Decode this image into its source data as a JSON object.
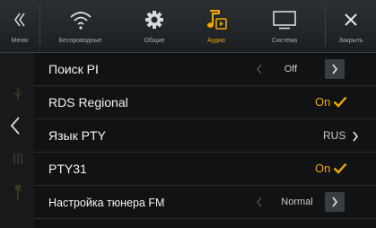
{
  "topbar": {
    "menu_label": "Меню",
    "tabs": [
      {
        "label": "Беспроводные",
        "icon": "wifi-icon"
      },
      {
        "label": "Общие",
        "icon": "gear-icon"
      },
      {
        "label": "Аудио",
        "icon": "music-note-icon",
        "active": true
      },
      {
        "label": "Система",
        "icon": "monitor-icon"
      }
    ],
    "close_label": "Закрыть"
  },
  "colors": {
    "accent": "#f2a800",
    "background": "#101214",
    "topbar": "#23272a"
  },
  "settings": [
    {
      "label": "Поиск PI",
      "value": "Off",
      "control": "arrows"
    },
    {
      "label": "RDS Regional",
      "value": "On",
      "control": "check"
    },
    {
      "label": "Язык PTY",
      "value": "RUS",
      "control": "next"
    },
    {
      "label": "PTY31",
      "value": "On",
      "control": "check"
    },
    {
      "label": "Настройка тюнера FM",
      "value": "Normal",
      "control": "arrows"
    }
  ]
}
